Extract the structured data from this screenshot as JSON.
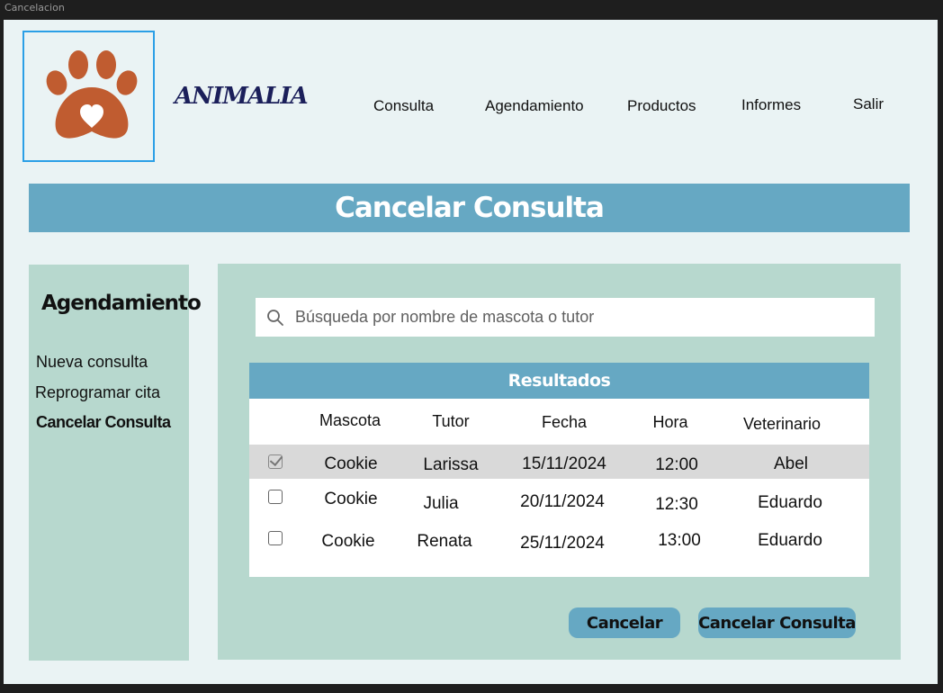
{
  "window": {
    "title": "Cancelacion"
  },
  "brand": {
    "name": "ANIMALIA",
    "logo_color": "#c05c30"
  },
  "nav": {
    "items": [
      {
        "label": "Consulta"
      },
      {
        "label": "Agendamiento"
      },
      {
        "label": "Productos"
      },
      {
        "label": "Informes"
      },
      {
        "label": "Salir"
      }
    ]
  },
  "page": {
    "title": "Cancelar Consulta"
  },
  "sidebar": {
    "title": "Agendamiento",
    "items": [
      {
        "label": "Nueva consulta"
      },
      {
        "label": "Reprogramar cita"
      },
      {
        "label": "Cancelar Consulta",
        "active": true
      }
    ]
  },
  "search": {
    "placeholder": "Búsqueda por nombre de mascota o tutor",
    "value": ""
  },
  "results": {
    "title": "Resultados",
    "columns": [
      "Mascota",
      "Tutor",
      "Fecha",
      "Hora",
      "Veterinario"
    ],
    "rows": [
      {
        "checked": true,
        "cells": [
          "Cookie",
          "Larissa",
          "15/11/2024",
          "12:00",
          "Abel"
        ]
      },
      {
        "checked": false,
        "cells": [
          "Cookie",
          "Julia",
          "20/11/2024",
          "12:30",
          "Eduardo"
        ]
      },
      {
        "checked": false,
        "cells": [
          "Cookie",
          "Renata",
          "25/11/2024",
          "13:00",
          "Eduardo"
        ]
      }
    ]
  },
  "actions": {
    "cancel_label": "Cancelar",
    "confirm_label": "Cancelar Consulta"
  },
  "colors": {
    "background": "#eaf3f4",
    "panel": "#b7d8ce",
    "accent": "#66a8c3",
    "selected_row": "#d9d9d9",
    "logo_border": "#2b9fe6"
  }
}
